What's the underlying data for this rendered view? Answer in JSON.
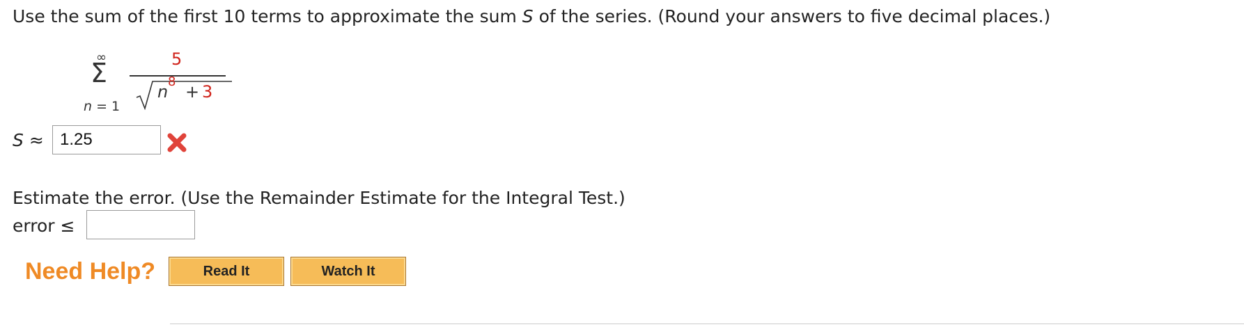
{
  "question": {
    "prompt": "Use the sum of the first 10 terms to approximate the sum S of the series. (Round your answers to five decimal places.)",
    "prompt_before_var": "Use the sum of the first 10 terms to approximate the sum ",
    "prompt_var": "S",
    "prompt_after_var": " of the series. (Round your answers to five decimal places.)"
  },
  "series": {
    "upper_limit": "∞",
    "sigma": "Σ",
    "index_var": "n",
    "index_equals": "= 1",
    "numerator": "5",
    "radicand_base": "n",
    "radicand_exponent": "8",
    "radicand_plus": "+",
    "radicand_constant": "3"
  },
  "answer_s": {
    "label_var": "S",
    "label_sym": "≈",
    "value": "1.25",
    "status": "incorrect"
  },
  "error_part": {
    "instruction": "Estimate the error. (Use the Remainder Estimate for the Integral Test.)",
    "label": "error ≤",
    "value": ""
  },
  "help": {
    "label": "Need Help?",
    "buttons": [
      "Read It",
      "Watch It"
    ]
  },
  "colors": {
    "accent_orange": "#ef8a25",
    "button_fill": "#f6bc58",
    "incorrect_red": "#d0231b"
  }
}
